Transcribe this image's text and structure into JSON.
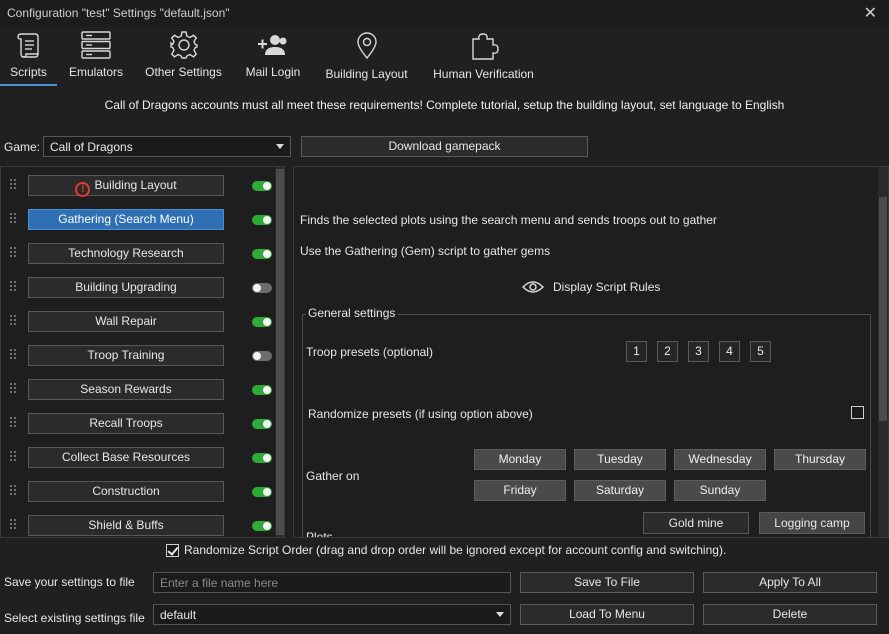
{
  "window": {
    "title": "Configuration \"test\" Settings \"default.json\"",
    "close_glyph": "✕"
  },
  "toolbar": {
    "items": [
      {
        "label": "Scripts",
        "icon": "scroll-icon",
        "active": true
      },
      {
        "label": "Emulators",
        "icon": "server-icon"
      },
      {
        "label": "Other Settings",
        "icon": "gear-icon"
      },
      {
        "label": "Mail Login",
        "icon": "add-user-icon"
      },
      {
        "label": "Building Layout",
        "icon": "map-pin-icon"
      },
      {
        "label": "Human Verification",
        "icon": "puzzle-icon"
      }
    ]
  },
  "notice": "Call of Dragons accounts must all meet these requirements! Complete tutorial, setup the building layout, set language to English",
  "game": {
    "label": "Game:",
    "selected": "Call of Dragons",
    "download_label": "Download gamepack"
  },
  "scripts": [
    {
      "label": "Building Layout",
      "enabled": true,
      "warning": true,
      "warning_glyph": "!"
    },
    {
      "label": "Gathering (Search Menu)",
      "enabled": true,
      "selected": true
    },
    {
      "label": "Technology Research",
      "enabled": true
    },
    {
      "label": "Building Upgrading",
      "enabled": false
    },
    {
      "label": "Wall Repair",
      "enabled": true
    },
    {
      "label": "Troop Training",
      "enabled": false
    },
    {
      "label": "Season Rewards",
      "enabled": true
    },
    {
      "label": "Recall Troops",
      "enabled": true
    },
    {
      "label": "Collect Base Resources",
      "enabled": true
    },
    {
      "label": "Construction",
      "enabled": true
    },
    {
      "label": "Shield & Buffs",
      "enabled": true
    }
  ],
  "detail": {
    "description": "Finds the selected plots using the search menu and sends troops out to gather",
    "hint": "Use the Gathering (Gem) script to gather gems",
    "rules_label": "Display Script Rules",
    "general_settings": "General settings",
    "troop_presets_label": "Troop presets (optional)",
    "presets": [
      "1",
      "2",
      "3",
      "4",
      "5"
    ],
    "randomize_presets_label": "Randomize presets (if using option above)",
    "gather_on_label": "Gather on",
    "days": [
      "Monday",
      "Tuesday",
      "Wednesday",
      "Thursday",
      "Friday",
      "Saturday",
      "Sunday"
    ],
    "plots_label": "Plots",
    "resources": [
      "Gold mine",
      "Logging camp"
    ]
  },
  "randomize_order_label": "Randomize Script Order (drag and drop order will be ignored except for account config and switching).",
  "save": {
    "label": "Save your settings to file",
    "placeholder": "Enter a file name here",
    "save_button": "Save To File",
    "apply_button": "Apply To All"
  },
  "load": {
    "label": "Select existing settings file",
    "selected": "default",
    "load_button": "Load To Menu",
    "delete_button": "Delete"
  },
  "colors": {
    "accent": "#2f6fb3",
    "toggle_on": "#2eaa3a",
    "toggle_off": "#6c6c6c",
    "warning": "#e53935"
  }
}
